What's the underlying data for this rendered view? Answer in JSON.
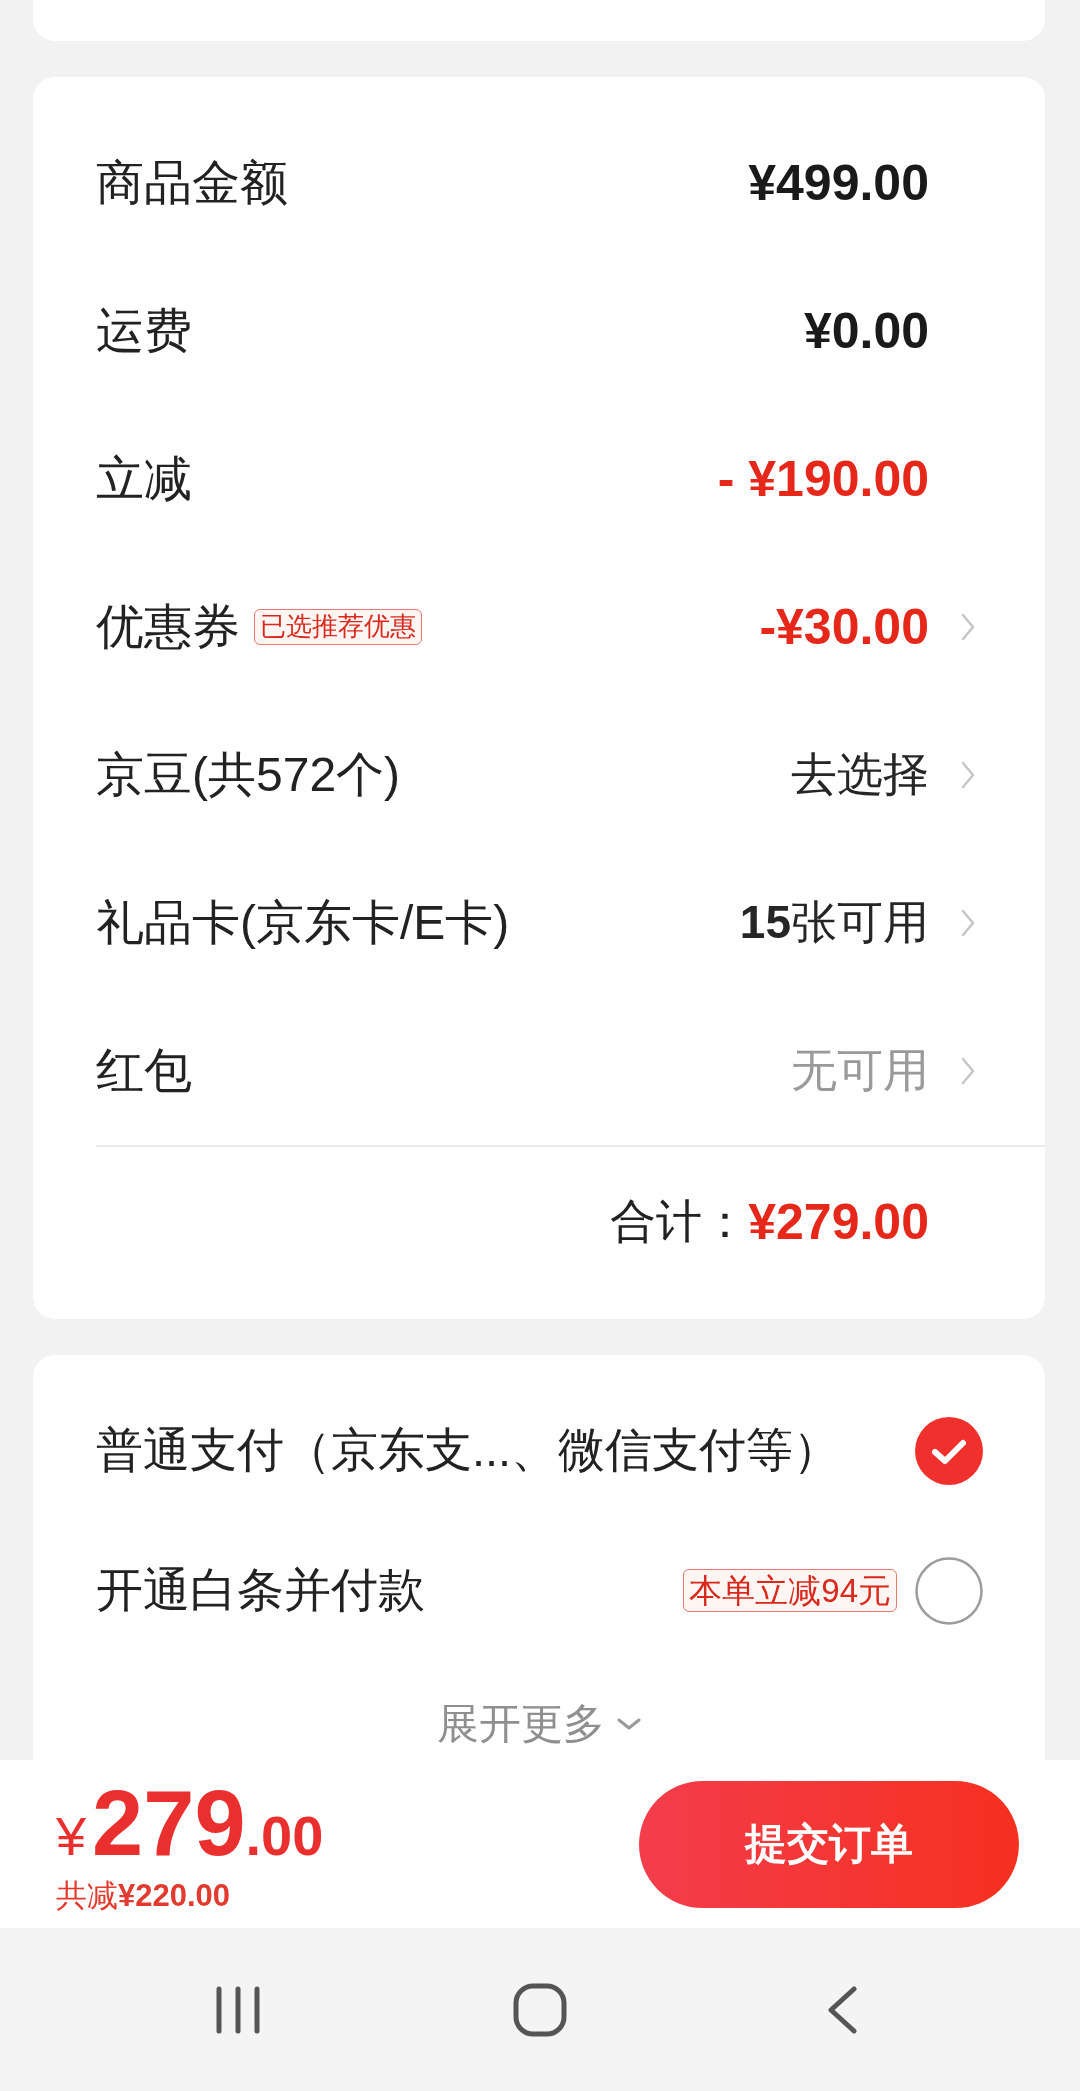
{
  "summary": {
    "rows": [
      {
        "label": "商品金额",
        "value": "¥499.00",
        "kind": "amount",
        "arrow": false
      },
      {
        "label": "运费",
        "value": "¥0.00",
        "kind": "amount",
        "arrow": false
      },
      {
        "label": "立减",
        "value": "- ¥190.00",
        "kind": "discount",
        "arrow": false
      },
      {
        "label": "优惠券",
        "tag": "已选推荐优惠",
        "value": "-¥30.00",
        "kind": "discount",
        "arrow": true
      },
      {
        "label": "京豆(共572个)",
        "value": "去选择",
        "kind": "action",
        "arrow": true
      },
      {
        "label": "礼品卡(京东卡/E卡)",
        "value": "**15**张可用",
        "kind": "action",
        "arrow": true
      },
      {
        "label": "红包",
        "value": "无可用",
        "kind": "unavailable",
        "arrow": true
      }
    ],
    "total": {
      "label": "合计：",
      "value": "¥279.00"
    }
  },
  "payment_methods": [
    {
      "label": "普通支付（京东支...、微信支付等）",
      "selected": true
    },
    {
      "label": "开通白条并付款",
      "tag": "本单立减94元",
      "selected": false
    }
  ],
  "expand": "展开更多",
  "checkout": {
    "price": "¥279.00",
    "saving": "共减**¥220.00**",
    "submit": "提交订单"
  }
}
